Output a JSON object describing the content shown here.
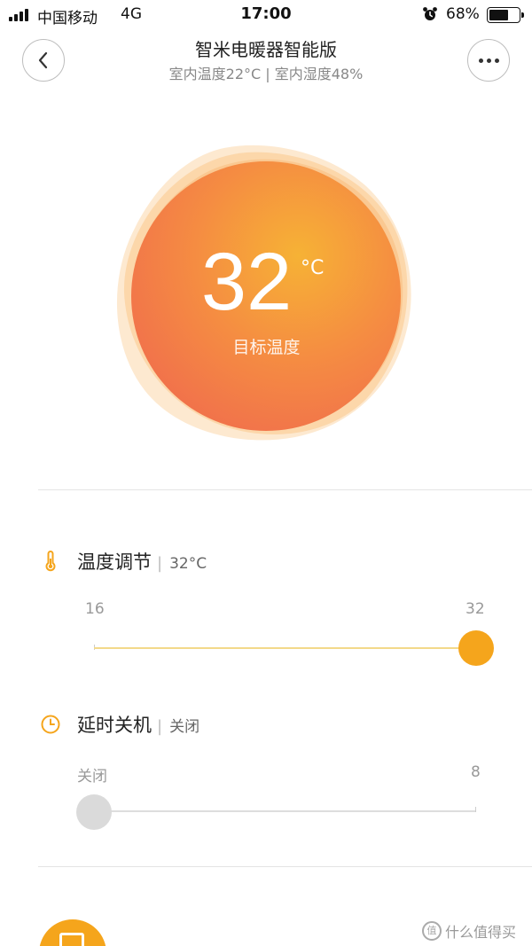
{
  "status_bar": {
    "carrier": "中国移动",
    "network": "4G",
    "time": "17:00",
    "battery_percent": "68%",
    "battery_level": 0.68,
    "icons": [
      "signal-icon",
      "alarm-icon",
      "battery-icon"
    ]
  },
  "header": {
    "title": "智米电暖器智能版",
    "subtitle": "室内温度22°C | 室内湿度48%",
    "back_icon": "chevron-left-icon",
    "more_icon": "more-dots-icon"
  },
  "hero": {
    "temperature": "32",
    "unit": "°C",
    "label": "目标温度"
  },
  "temperature_setting": {
    "title": "温度调节",
    "value": "32°C",
    "min_label": "16",
    "max_label": "32",
    "level": 1.0,
    "icon": "thermometer-icon"
  },
  "timer_setting": {
    "title": "延时关机",
    "value": "关闭",
    "min_label": "关闭",
    "max_label": "8",
    "level": 0.0,
    "icon": "clock-icon"
  },
  "watermark": {
    "text": "什么值得买"
  },
  "colors": {
    "accent": "#f5a51c",
    "hero_gradient_center": "#f6a83a",
    "hero_gradient_edge": "#f27b4a",
    "track_active": "#f3d98a",
    "track_inactive": "#dddddd",
    "thumb_inactive": "#dadada"
  }
}
